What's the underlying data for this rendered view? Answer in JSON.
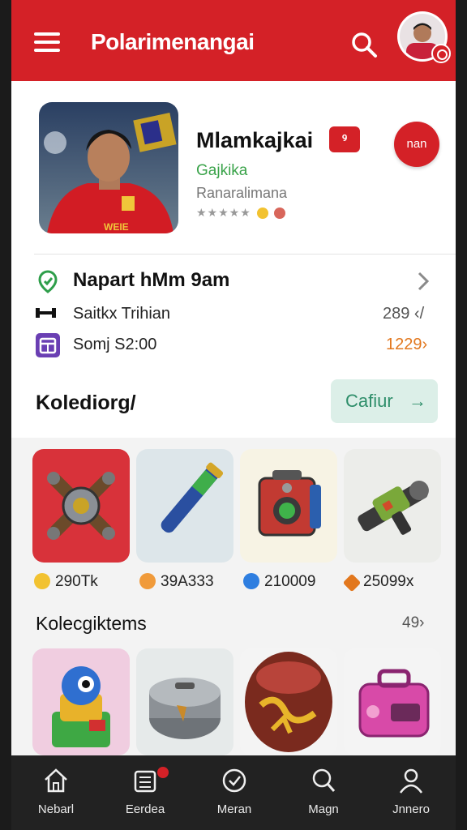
{
  "header": {
    "title": "Polarimenangai",
    "menu_icon": "hamburger-menu-icon",
    "search_icon": "search-icon",
    "accent_color": "#d42127"
  },
  "profile": {
    "name": "Mlamkajkai",
    "badge": "ꝰ",
    "subtitle": "Gajkika",
    "meta": "Ranaralimana",
    "rating": "★★★★★",
    "action_button": "nan"
  },
  "info_rows": [
    {
      "icon": "location-pin-icon",
      "label": "Napart hMm 9am"
    },
    {
      "icon": "dumbbell-icon",
      "label": "Saitkx Trihian",
      "value": "289 ‹/"
    },
    {
      "icon": "calendar-icon",
      "label": "Somj S2:00",
      "value": "1229›"
    }
  ],
  "section1": {
    "title": "Kolediorg/",
    "button_label": "Cafiur",
    "button_arrow": "→"
  },
  "items": [
    {
      "name": "cross-cannon-item",
      "price": "290Tk",
      "coin_color": "#f2c230"
    },
    {
      "name": "blue-bat-item",
      "price": "39A333",
      "coin_color": "#f09a3a"
    },
    {
      "name": "red-speaker-item",
      "price": "210009",
      "coin_color": "#2e7ee0"
    },
    {
      "name": "green-blaster-item",
      "price": "25099x",
      "coin_color": "#e2771d"
    }
  ],
  "section2": {
    "title": "Kolecgiktems",
    "count": "49›"
  },
  "collection": [
    {
      "name": "green-robot-item"
    },
    {
      "name": "steel-pot-item"
    },
    {
      "name": "painted-drum-item"
    },
    {
      "name": "pink-case-item"
    }
  ],
  "nav": [
    {
      "icon": "home-icon",
      "label": "Nebarl"
    },
    {
      "icon": "list-icon",
      "label": "Eerdea"
    },
    {
      "icon": "check-circle-icon",
      "label": "Meran"
    },
    {
      "icon": "search-icon",
      "label": "Magn"
    },
    {
      "icon": "profile-icon",
      "label": "Jnnero"
    }
  ]
}
